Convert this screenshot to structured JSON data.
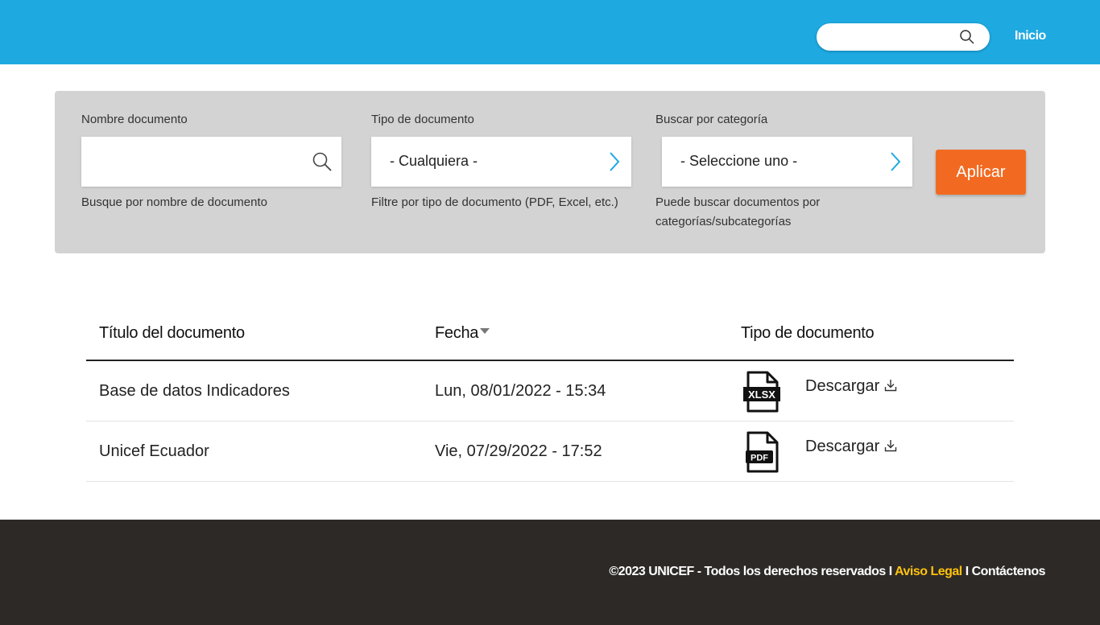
{
  "header": {
    "search_placeholder": "",
    "nav_inicio": "Inicio",
    "colors": {
      "header_bg": "#1ea9e1"
    }
  },
  "filters": {
    "name": {
      "label": "Nombre documento",
      "value": "",
      "help": "Busque por nombre de documento"
    },
    "type": {
      "label": "Tipo de documento",
      "selected": "- Cualquiera -",
      "help": "Filtre por tipo de documento (PDF, Excel, etc.)"
    },
    "category": {
      "label": "Buscar por categoría",
      "selected": "- Seleccione uno -",
      "help_line1": "Puede buscar documentos por",
      "help_line2": "categorías/subcategorías"
    },
    "apply_label": "Aplicar",
    "colors": {
      "panel_bg": "#d3d3d3",
      "apply_bg": "#f26a21",
      "chevron": "#1ea9e1"
    }
  },
  "table": {
    "headers": {
      "title": "Título del documento",
      "date": "Fecha",
      "type": "Tipo de documento"
    },
    "rows": [
      {
        "title": "Base de datos Indicadores",
        "date": "Lun, 08/01/2022 - 15:34",
        "file_type": "XLSX",
        "icon": "xlsx-file-icon",
        "action": "Descargar"
      },
      {
        "title": "Unicef Ecuador",
        "date": "Vie, 07/29/2022 - 17:52",
        "file_type": "PDF",
        "icon": "pdf-file-icon",
        "action": "Descargar"
      }
    ]
  },
  "footer": {
    "copyright": "©2023 UNICEF - Todos los derechos reservados I ",
    "legal": "Aviso Legal",
    "separator": " I ",
    "contact": "Contáctenos",
    "colors": {
      "footer_bg": "#2d2926",
      "legal": "#ffc20e"
    }
  }
}
